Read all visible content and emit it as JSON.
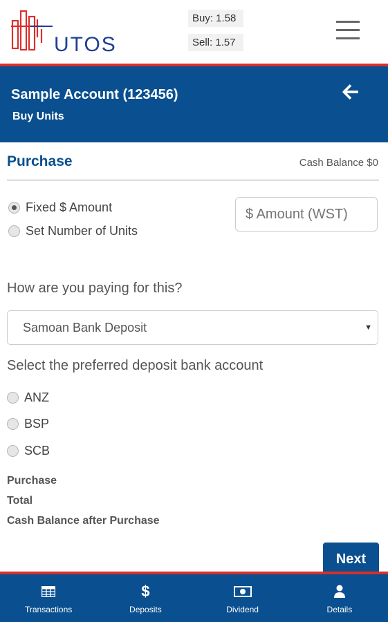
{
  "header": {
    "logo_text": "UTOS",
    "buy_rate": "Buy: 1.58",
    "sell_rate": "Sell: 1.57",
    "menu_icon": "hamburger-menu-icon"
  },
  "account": {
    "title": "Sample Account (123456)",
    "subtitle": "Buy Units",
    "back_icon": "arrow-left-icon"
  },
  "purchase": {
    "title": "Purchase",
    "cash_balance": "Cash Balance $0",
    "options": [
      {
        "label": "Fixed $ Amount",
        "selected": true
      },
      {
        "label": "Set Number of Units",
        "selected": false
      }
    ],
    "amount_placeholder": "$ Amount (WST)"
  },
  "payment": {
    "question": "How are you paying for this?",
    "method_selected": "Samoan Bank Deposit"
  },
  "bank": {
    "question": "Select the preferred deposit bank account",
    "options": [
      "ANZ",
      "BSP",
      "SCB"
    ]
  },
  "summary": {
    "purchase": "Purchase",
    "total": "Total",
    "after": "Cash Balance after Purchase"
  },
  "next_label": "Next",
  "colors": {
    "primary": "#0a4f8f",
    "accent": "#d9302b"
  },
  "nav": [
    {
      "label": "Transactions",
      "icon": "table-icon"
    },
    {
      "label": "Deposits",
      "icon": "dollar-icon"
    },
    {
      "label": "Dividend",
      "icon": "money-icon"
    },
    {
      "label": "Details",
      "icon": "user-icon"
    }
  ]
}
